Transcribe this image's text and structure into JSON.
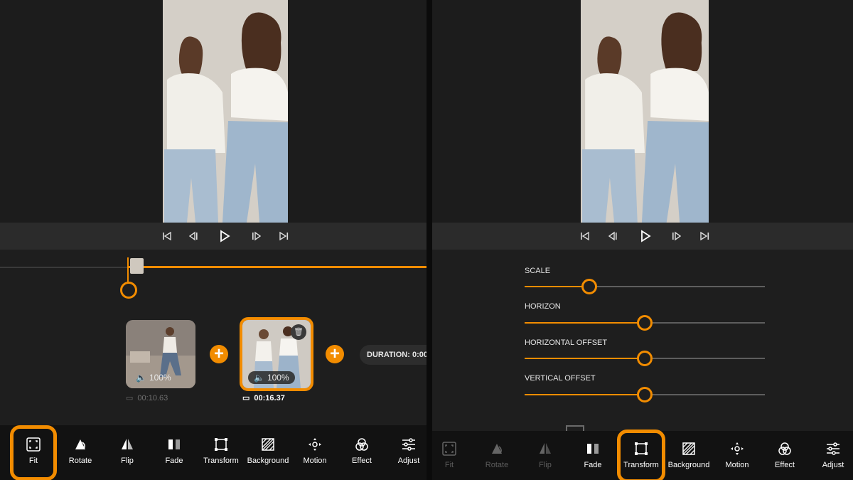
{
  "accent": "#f28c00",
  "left": {
    "player_controls": [
      "skip-start-icon",
      "prev-frame-icon",
      "play-icon",
      "next-frame-icon",
      "skip-end-icon"
    ],
    "clips": [
      {
        "volume": "100%",
        "duration": "00:10.63",
        "selected": false
      },
      {
        "volume": "100%",
        "duration": "00:16.37",
        "selected": true
      }
    ],
    "duration_label": "DURATION: 0:00",
    "toolbar": [
      {
        "label": "Fit",
        "icon": "fit-icon"
      },
      {
        "label": "Rotate",
        "icon": "rotate-icon"
      },
      {
        "label": "Flip",
        "icon": "flip-icon"
      },
      {
        "label": "Fade",
        "icon": "fade-icon"
      },
      {
        "label": "Transform",
        "icon": "transform-icon"
      },
      {
        "label": "Background",
        "icon": "background-icon"
      },
      {
        "label": "Motion",
        "icon": "motion-icon"
      },
      {
        "label": "Effect",
        "icon": "effect-icon"
      },
      {
        "label": "Adjust",
        "icon": "adjust-icon"
      }
    ],
    "selected_tool": "Fit"
  },
  "right": {
    "sliders": [
      {
        "label": "SCALE",
        "value": 0.27
      },
      {
        "label": "HORIZON",
        "value": 0.5
      },
      {
        "label": "HORIZONTAL OFFSET",
        "value": 0.5
      },
      {
        "label": "VERTICAL OFFSET",
        "value": 0.5
      }
    ],
    "toolbar": [
      {
        "label": "Fit",
        "icon": "fit-icon",
        "disabled": true
      },
      {
        "label": "Rotate",
        "icon": "rotate-icon",
        "disabled": true
      },
      {
        "label": "Flip",
        "icon": "flip-icon",
        "disabled": true
      },
      {
        "label": "Fade",
        "icon": "fade-icon",
        "disabled": false
      },
      {
        "label": "Transform",
        "icon": "transform-icon",
        "disabled": false
      },
      {
        "label": "Background",
        "icon": "background-icon",
        "disabled": false
      },
      {
        "label": "Motion",
        "icon": "motion-icon",
        "disabled": false
      },
      {
        "label": "Effect",
        "icon": "effect-icon",
        "disabled": false
      },
      {
        "label": "Adjust",
        "icon": "adjust-icon",
        "disabled": false
      }
    ],
    "selected_tool": "Transform"
  }
}
